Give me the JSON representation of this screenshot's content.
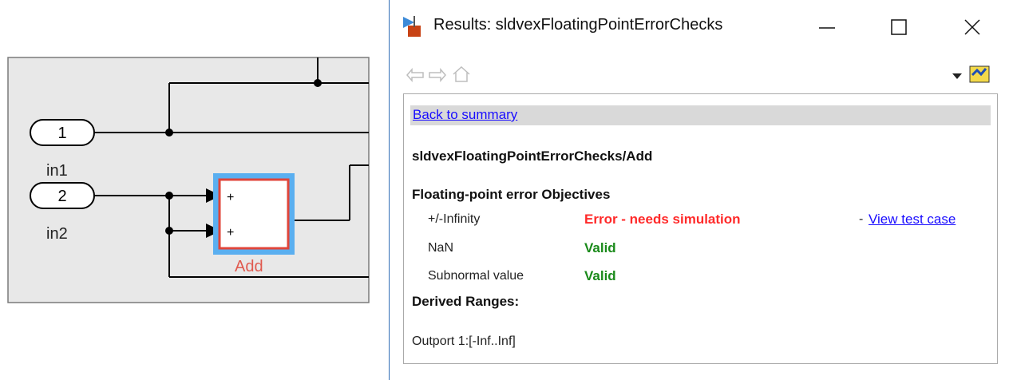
{
  "model": {
    "inports": [
      {
        "number": "1",
        "label": "in1"
      },
      {
        "number": "2",
        "label": "in2"
      }
    ],
    "add_block": {
      "label": "Add",
      "signs": [
        "+",
        "+"
      ]
    }
  },
  "window": {
    "title": "Results: sldvexFloatingPointErrorChecks",
    "controls": {
      "minimize": "—",
      "maximize": "☐",
      "close": "✕"
    },
    "nav_icons": [
      "back-arrow-icon",
      "forward-arrow-icon",
      "home-icon"
    ],
    "back_link": "Back to summary",
    "block_path": "sldvexFloatingPointErrorChecks/Add",
    "objectives_heading": "Floating-point error Objectives",
    "objectives": [
      {
        "name": "+/-Infinity",
        "status": "Error - needs simulation",
        "status_type": "error",
        "link_prefix": "- ",
        "link": "View test case"
      },
      {
        "name": "NaN",
        "status": "Valid",
        "status_type": "valid"
      },
      {
        "name": "Subnormal value",
        "status": "Valid",
        "status_type": "valid"
      }
    ],
    "derived_heading": "Derived Ranges:",
    "derived_value": "Outport 1:[-Inf..Inf]"
  },
  "colors": {
    "error": "#ff2a2a",
    "valid": "#1a8a1a",
    "link": "#1a0dff",
    "add_label": "#e05a4f",
    "add_highlight": "#5aaff0",
    "add_border": "#e0453a"
  }
}
